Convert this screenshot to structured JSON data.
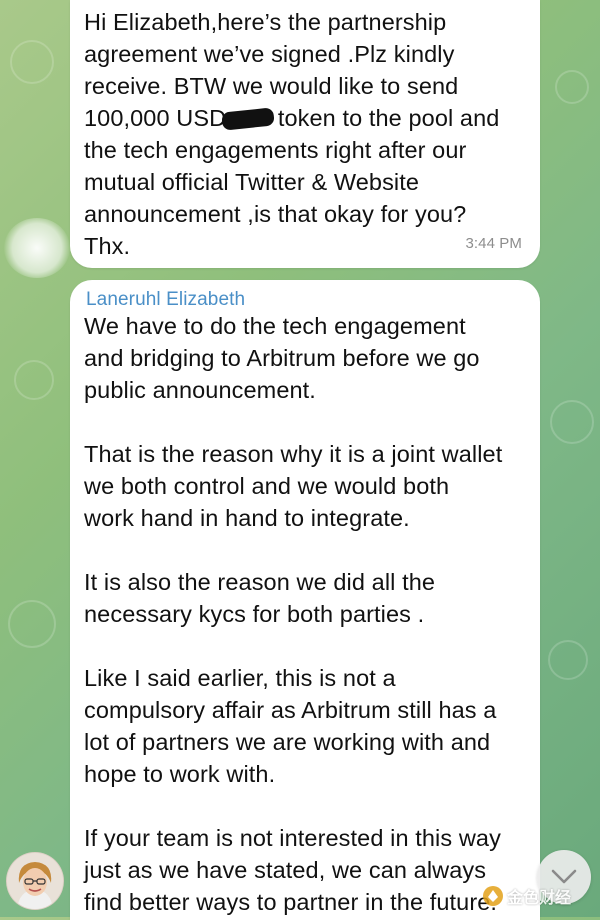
{
  "chat": {
    "messages": [
      {
        "text": "Hi Elizabeth,here’s the partnership\nagreement we’ve signed .Plz kindly\nreceive. BTW we would like to send",
        "text_before_redaction": "100,000 USD",
        "text_after_redaction": " token to the pool  and",
        "text_rest": "the tech engagements right after our\nmutual official Twitter & Website\nannouncement ,is that okay for you?\nThx.",
        "time": "3:44 PM"
      },
      {
        "sender": "Laneruhl Elizabeth",
        "text": "We have to do the tech engagement\nand bridging to Arbitrum before we go\npublic announcement.\n\nThat is the reason why it is a joint wallet\nwe both control and we would both\nwork hand in hand to integrate.\n\nIt is also the reason we did all the\nnecessary kycs for both parties .\n\nLike I said earlier, this is not a\ncompulsory affair as Arbitrum still has a\nlot of partners we are working with and\nhope to work with.\n\nIf your team is not interested in this way\njust as we have stated,  we can always\nfind better ways to partner in the future."
      }
    ]
  },
  "watermark": {
    "text": "金色财经"
  },
  "colors": {
    "sender_name": "#4a8fc7",
    "bubble": "#ffffff",
    "timestamp": "#8d8d8d"
  },
  "icons": {
    "scroll_down": "chevron-down-icon",
    "avatar": "profile-photo"
  }
}
